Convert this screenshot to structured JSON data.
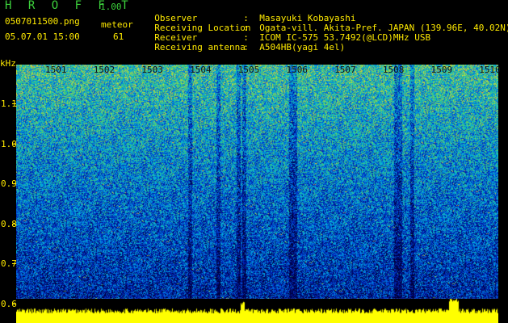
{
  "header": {
    "app_name": "H R O F F T",
    "version": "1.00",
    "filename": "0507011500.png",
    "meteor_label": "meteor",
    "datetime": "05.07.01 15:00",
    "meteor_count": "61"
  },
  "info": {
    "rows": [
      {
        "label": "Observer",
        "value": "Masayuki Kobayashi"
      },
      {
        "label": "Receiving Location",
        "value": "Ogata-vill. Akita-Pref. JAPAN (139.96E, 40.02N)"
      },
      {
        "label": "Receiver",
        "value": "ICOM IC-575 53.7492(@LCD)MHz USB"
      },
      {
        "label": "Receiving antenna",
        "value": "A504HB(yagi 4el)"
      }
    ],
    "separator": ":"
  },
  "spectrogram": {
    "y_unit": "kHz",
    "y_ticks": [
      "1.1",
      "1.0",
      "0.9",
      "0.8",
      "0.7",
      "0.6"
    ],
    "x_ticks": [
      "1501",
      "1502",
      "1503",
      "1504",
      "1505",
      "1506",
      "1507",
      "1508",
      "1509",
      "1510"
    ],
    "colors": {
      "text_green": "#3cd13c",
      "text_yellow": "#ffea00",
      "amplitude": "#ffff00"
    }
  }
}
